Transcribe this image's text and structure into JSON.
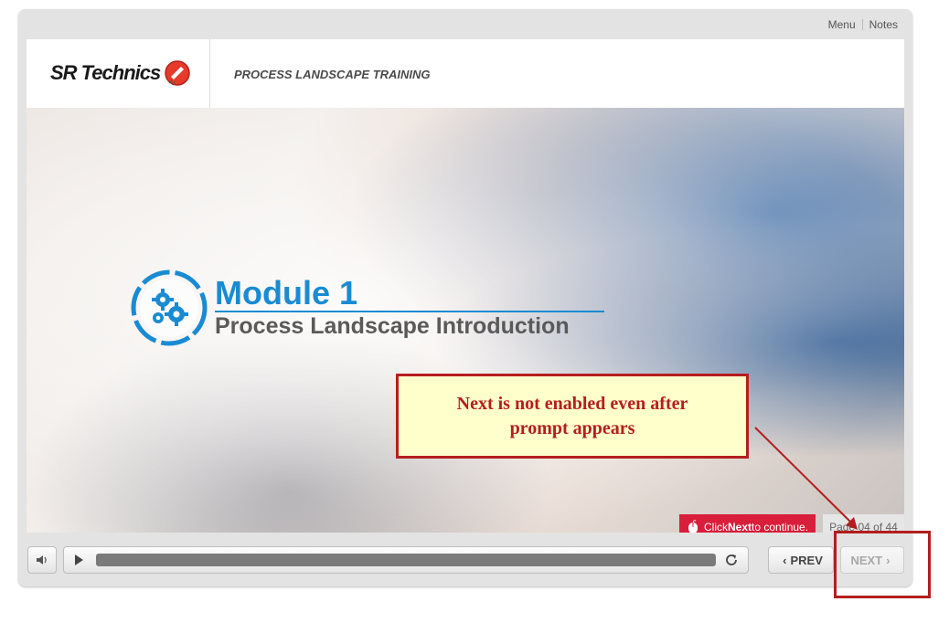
{
  "top_links": {
    "menu": "Menu",
    "notes": "Notes"
  },
  "header": {
    "logo_text": "SR Technics",
    "course_title": "PROCESS LANDSCAPE TRAINING"
  },
  "slide": {
    "module_title": "Module 1",
    "module_subtitle": "Process Landscape Introduction"
  },
  "prompt": {
    "pre": "Click ",
    "bold": "Next",
    "post": " to continue."
  },
  "page_counter": "Page 04 of 44",
  "controls": {
    "prev_label": "PREV",
    "next_label": "NEXT"
  },
  "annotation": {
    "callout_text": "Next is not enabled even after prompt appears"
  },
  "colors": {
    "accent_blue": "#1a8bd2",
    "prompt_red": "#d81e3a",
    "annotation_red": "#b41e1e",
    "callout_fill": "#ffffcc"
  },
  "icons": [
    "gears-icon",
    "mouse-icon",
    "volume-icon",
    "play-icon",
    "replay-icon",
    "chevron-left-icon",
    "chevron-right-icon",
    "logo-icon"
  ]
}
